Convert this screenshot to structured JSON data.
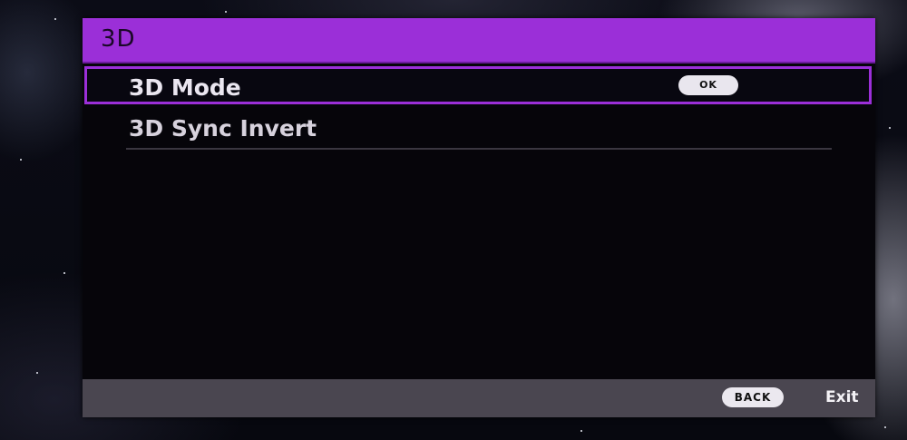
{
  "menu": {
    "title": "3D",
    "items": [
      {
        "label": "3D Mode",
        "button_label": "OK",
        "selected": true
      },
      {
        "label": "3D Sync Invert",
        "selected": false
      }
    ]
  },
  "footer": {
    "back_label": "BACK",
    "exit_label": "Exit"
  },
  "colors": {
    "accent": "#9b2fd8",
    "panel_background": "#06050a",
    "footer_background": "#4a4650",
    "text": "#eae6f0"
  }
}
